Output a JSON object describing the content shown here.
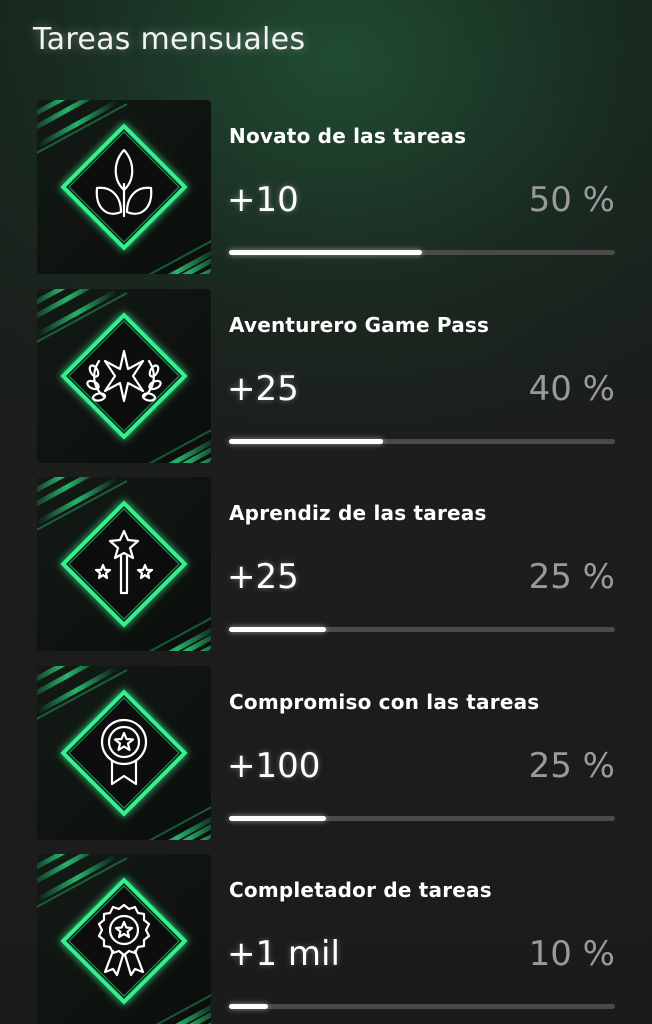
{
  "header": {
    "title": "Tareas mensuales"
  },
  "colors": {
    "accent": "#2ee58a",
    "progress_fill": "#ffffff",
    "progress_track": "#4a4a4a"
  },
  "tasks": [
    {
      "name": "Novato de las tareas",
      "points": "+10",
      "percent_label": "50 %",
      "progress": 0.5,
      "icon": "sprout-icon"
    },
    {
      "name": "Aventurero Game Pass",
      "points": "+25",
      "percent_label": "40 %",
      "progress": 0.4,
      "icon": "star-laurel-icon"
    },
    {
      "name": "Aprendiz de las tareas",
      "points": "+25",
      "percent_label": "25 %",
      "progress": 0.25,
      "icon": "magic-wand-icon"
    },
    {
      "name": "Compromiso con las tareas",
      "points": "+100",
      "percent_label": "25 %",
      "progress": 0.25,
      "icon": "medal-ribbon-icon"
    },
    {
      "name": "Completador de tareas",
      "points": "+1 mil",
      "percent_label": "10 %",
      "progress": 0.1,
      "icon": "rosette-award-icon"
    }
  ]
}
